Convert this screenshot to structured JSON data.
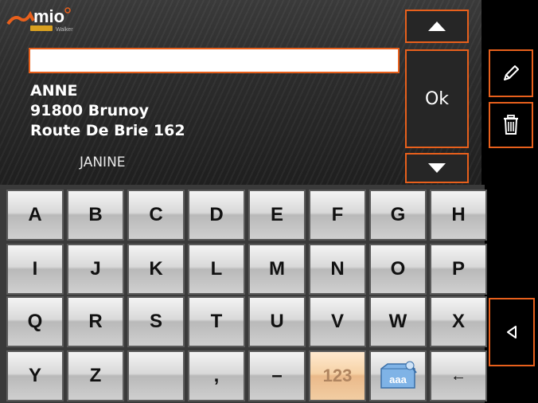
{
  "brand": {
    "logo_text": "mio",
    "sub_text": "Walker"
  },
  "search": {
    "value": "",
    "placeholder": ""
  },
  "contact": {
    "name": "ANNE",
    "city": "91800 Brunoy",
    "street": "Route De Brie 162"
  },
  "next_contact": "JANINE",
  "buttons": {
    "ok_label": "Ok",
    "up_icon": "triangle-up-icon",
    "down_icon": "triangle-down-icon",
    "edit_icon": "pencil-icon",
    "delete_icon": "trash-icon",
    "back_icon": "triangle-left-icon"
  },
  "keyboard": {
    "rows": [
      [
        "A",
        "B",
        "C",
        "D",
        "E",
        "F",
        "G",
        "H"
      ],
      [
        "I",
        "J",
        "K",
        "L",
        "M",
        "N",
        "O",
        "P"
      ],
      [
        "Q",
        "R",
        "S",
        "T",
        "U",
        "V",
        "W",
        "X"
      ],
      [
        "Y",
        "Z",
        "",
        ",",
        "–",
        "123",
        "",
        "←"
      ]
    ],
    "mode_icon_text": "aaa"
  },
  "colors": {
    "accent": "#e8601c",
    "background": "#000000"
  }
}
